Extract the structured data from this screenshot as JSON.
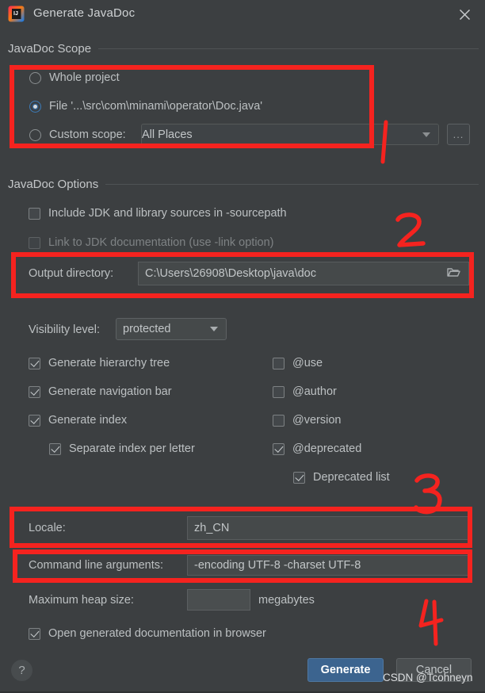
{
  "window": {
    "title": "Generate JavaDoc",
    "app_icon": "intellij-idea-icon",
    "close_icon": "close-icon"
  },
  "scope_section": {
    "header": "JavaDoc Scope",
    "options": [
      {
        "label": "Whole project",
        "selected": false
      },
      {
        "label": "File '...\\src\\com\\minami\\operator\\Doc.java'",
        "selected": true
      },
      {
        "label": "Custom scope:",
        "selected": false
      }
    ],
    "custom_scope_placeholder": "All Places",
    "custom_scope_value": "",
    "ellipsis_label": "...",
    "dropdown_icon": "chevron-down-icon"
  },
  "options_section": {
    "header": "JavaDoc Options",
    "checkboxes_top": [
      {
        "label": "Include JDK and library sources in -sourcepath",
        "checked": false,
        "disabled": false
      },
      {
        "label": "Link to JDK documentation (use -link option)",
        "checked": false,
        "disabled": true
      }
    ],
    "output_directory": {
      "label": "Output directory:",
      "value": "C:\\Users\\26908\\Desktop\\java\\doc",
      "browse_icon": "folder-icon"
    },
    "visibility": {
      "label": "Visibility level:",
      "value": "protected",
      "dropdown_icon": "chevron-down-icon"
    },
    "checkboxes_left": [
      {
        "label": "Generate hierarchy tree",
        "checked": true,
        "indent": 0
      },
      {
        "label": "Generate navigation bar",
        "checked": true,
        "indent": 0
      },
      {
        "label": "Generate index",
        "checked": true,
        "indent": 0
      },
      {
        "label": "Separate index per letter",
        "checked": true,
        "indent": 1
      }
    ],
    "checkboxes_right": [
      {
        "label": "@use",
        "checked": false,
        "indent": 0
      },
      {
        "label": "@author",
        "checked": false,
        "indent": 0
      },
      {
        "label": "@version",
        "checked": false,
        "indent": 0
      },
      {
        "label": "@deprecated",
        "checked": true,
        "indent": 0
      },
      {
        "label": "Deprecated list",
        "checked": true,
        "indent": 1
      }
    ],
    "locale": {
      "label": "Locale:",
      "value": "zh_CN"
    },
    "command_line": {
      "label": "Command line arguments:",
      "value": "-encoding UTF-8 -charset UTF-8"
    },
    "heap": {
      "label": "Maximum heap size:",
      "value": "",
      "unit": "megabytes"
    },
    "open_browser": {
      "label": "Open generated documentation in browser",
      "checked": true
    }
  },
  "footer": {
    "help_label": "?",
    "generate_label": "Generate",
    "cancel_label": "Cancel"
  },
  "annotations": {
    "marks": [
      "1",
      "2",
      "3",
      "4"
    ],
    "color": "#f5231f",
    "watermark": "CSDN @Tcohneyn"
  }
}
